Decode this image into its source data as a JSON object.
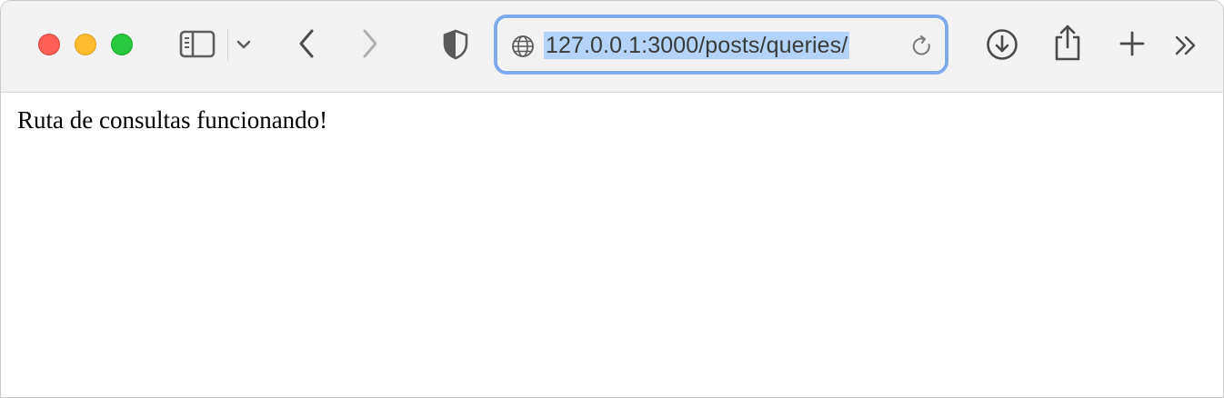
{
  "browser": {
    "window_controls": {
      "close_color": "#fe5f57",
      "minimize_color": "#febc2e",
      "maximize_color": "#28c840"
    },
    "toolbar": {
      "icons": {
        "sidebar": "sidebar-icon",
        "sidebar_menu": "chevron-down-icon",
        "back": "chevron-left-icon",
        "forward": "chevron-right-icon",
        "privacy": "shield-icon",
        "site": "globe-icon",
        "reload": "reload-icon",
        "downloads": "download-icon",
        "share": "share-icon",
        "new_tab": "plus-icon",
        "more": "double-chevron-right-icon"
      }
    },
    "address_bar": {
      "url": "127.0.0.1:3000/posts/queries/",
      "selected": true,
      "focus_ring_color": "#80a9ee"
    }
  },
  "page": {
    "body_text": "Ruta de consultas funcionando!"
  }
}
